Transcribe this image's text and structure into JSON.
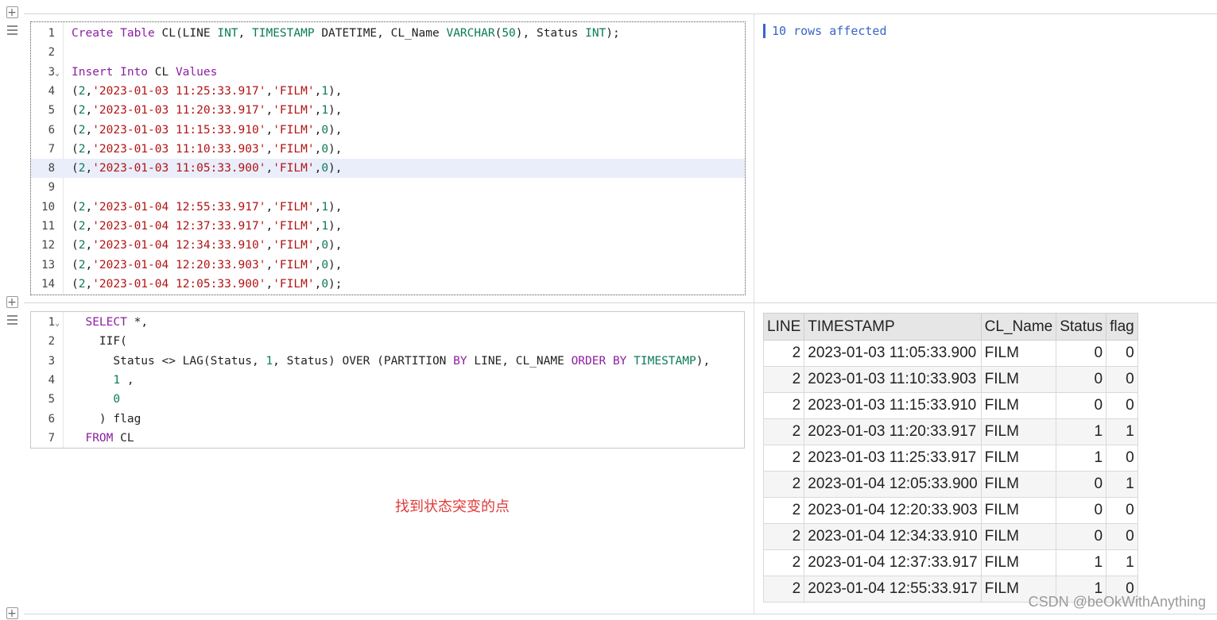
{
  "cell1": {
    "line_numbers": [
      "1",
      "2",
      "3",
      "4",
      "5",
      "6",
      "7",
      "8",
      "9",
      "10",
      "11",
      "12",
      "13",
      "14"
    ],
    "lines": [
      [
        {
          "t": "Create Table",
          "c": "kw"
        },
        {
          "t": " CL(LINE ",
          "c": "pl"
        },
        {
          "t": "INT",
          "c": "ty"
        },
        {
          "t": ", ",
          "c": "pl"
        },
        {
          "t": "TIMESTAMP",
          "c": "ty"
        },
        {
          "t": " DATETIME, CL_Name ",
          "c": "pl"
        },
        {
          "t": "VARCHAR",
          "c": "ty"
        },
        {
          "t": "(",
          "c": "pl"
        },
        {
          "t": "50",
          "c": "nu"
        },
        {
          "t": "), Status ",
          "c": "pl"
        },
        {
          "t": "INT",
          "c": "ty"
        },
        {
          "t": ");",
          "c": "pl"
        }
      ],
      [],
      [
        {
          "t": "Insert Into",
          "c": "kw"
        },
        {
          "t": " CL ",
          "c": "pl"
        },
        {
          "t": "Values",
          "c": "kw"
        }
      ],
      [
        {
          "t": "(",
          "c": "pl"
        },
        {
          "t": "2",
          "c": "nu"
        },
        {
          "t": ",",
          "c": "pl"
        },
        {
          "t": "'2023-01-03 11:25:33.917'",
          "c": "st"
        },
        {
          "t": ",",
          "c": "pl"
        },
        {
          "t": "'FILM'",
          "c": "st"
        },
        {
          "t": ",",
          "c": "pl"
        },
        {
          "t": "1",
          "c": "nu"
        },
        {
          "t": "),",
          "c": "pl"
        }
      ],
      [
        {
          "t": "(",
          "c": "pl"
        },
        {
          "t": "2",
          "c": "nu"
        },
        {
          "t": ",",
          "c": "pl"
        },
        {
          "t": "'2023-01-03 11:20:33.917'",
          "c": "st"
        },
        {
          "t": ",",
          "c": "pl"
        },
        {
          "t": "'FILM'",
          "c": "st"
        },
        {
          "t": ",",
          "c": "pl"
        },
        {
          "t": "1",
          "c": "nu"
        },
        {
          "t": "),",
          "c": "pl"
        }
      ],
      [
        {
          "t": "(",
          "c": "pl"
        },
        {
          "t": "2",
          "c": "nu"
        },
        {
          "t": ",",
          "c": "pl"
        },
        {
          "t": "'2023-01-03 11:15:33.910'",
          "c": "st"
        },
        {
          "t": ",",
          "c": "pl"
        },
        {
          "t": "'FILM'",
          "c": "st"
        },
        {
          "t": ",",
          "c": "pl"
        },
        {
          "t": "0",
          "c": "nu"
        },
        {
          "t": "),",
          "c": "pl"
        }
      ],
      [
        {
          "t": "(",
          "c": "pl"
        },
        {
          "t": "2",
          "c": "nu"
        },
        {
          "t": ",",
          "c": "pl"
        },
        {
          "t": "'2023-01-03 11:10:33.903'",
          "c": "st"
        },
        {
          "t": ",",
          "c": "pl"
        },
        {
          "t": "'FILM'",
          "c": "st"
        },
        {
          "t": ",",
          "c": "pl"
        },
        {
          "t": "0",
          "c": "nu"
        },
        {
          "t": "),",
          "c": "pl"
        }
      ],
      [
        {
          "t": "(",
          "c": "pl"
        },
        {
          "t": "2",
          "c": "nu"
        },
        {
          "t": ",",
          "c": "pl"
        },
        {
          "t": "'2023-01-03 11:05:33.900'",
          "c": "st"
        },
        {
          "t": ",",
          "c": "pl"
        },
        {
          "t": "'FILM'",
          "c": "st"
        },
        {
          "t": ",",
          "c": "pl"
        },
        {
          "t": "0",
          "c": "nu"
        },
        {
          "t": "),",
          "c": "pl"
        }
      ],
      [],
      [
        {
          "t": "(",
          "c": "pl"
        },
        {
          "t": "2",
          "c": "nu"
        },
        {
          "t": ",",
          "c": "pl"
        },
        {
          "t": "'2023-01-04 12:55:33.917'",
          "c": "st"
        },
        {
          "t": ",",
          "c": "pl"
        },
        {
          "t": "'FILM'",
          "c": "st"
        },
        {
          "t": ",",
          "c": "pl"
        },
        {
          "t": "1",
          "c": "nu"
        },
        {
          "t": "),",
          "c": "pl"
        }
      ],
      [
        {
          "t": "(",
          "c": "pl"
        },
        {
          "t": "2",
          "c": "nu"
        },
        {
          "t": ",",
          "c": "pl"
        },
        {
          "t": "'2023-01-04 12:37:33.917'",
          "c": "st"
        },
        {
          "t": ",",
          "c": "pl"
        },
        {
          "t": "'FILM'",
          "c": "st"
        },
        {
          "t": ",",
          "c": "pl"
        },
        {
          "t": "1",
          "c": "nu"
        },
        {
          "t": "),",
          "c": "pl"
        }
      ],
      [
        {
          "t": "(",
          "c": "pl"
        },
        {
          "t": "2",
          "c": "nu"
        },
        {
          "t": ",",
          "c": "pl"
        },
        {
          "t": "'2023-01-04 12:34:33.910'",
          "c": "st"
        },
        {
          "t": ",",
          "c": "pl"
        },
        {
          "t": "'FILM'",
          "c": "st"
        },
        {
          "t": ",",
          "c": "pl"
        },
        {
          "t": "0",
          "c": "nu"
        },
        {
          "t": "),",
          "c": "pl"
        }
      ],
      [
        {
          "t": "(",
          "c": "pl"
        },
        {
          "t": "2",
          "c": "nu"
        },
        {
          "t": ",",
          "c": "pl"
        },
        {
          "t": "'2023-01-04 12:20:33.903'",
          "c": "st"
        },
        {
          "t": ",",
          "c": "pl"
        },
        {
          "t": "'FILM'",
          "c": "st"
        },
        {
          "t": ",",
          "c": "pl"
        },
        {
          "t": "0",
          "c": "nu"
        },
        {
          "t": "),",
          "c": "pl"
        }
      ],
      [
        {
          "t": "(",
          "c": "pl"
        },
        {
          "t": "2",
          "c": "nu"
        },
        {
          "t": ",",
          "c": "pl"
        },
        {
          "t": "'2023-01-04 12:05:33.900'",
          "c": "st"
        },
        {
          "t": ",",
          "c": "pl"
        },
        {
          "t": "'FILM'",
          "c": "st"
        },
        {
          "t": ",",
          "c": "pl"
        },
        {
          "t": "0",
          "c": "nu"
        },
        {
          "t": ");",
          "c": "pl"
        }
      ]
    ],
    "fold_lines": [
      "3"
    ],
    "current_line": "8",
    "output_message": "10 rows affected"
  },
  "cell2": {
    "line_numbers": [
      "1",
      "2",
      "3",
      "4",
      "5",
      "6",
      "7"
    ],
    "lines": [
      [
        {
          "t": "  ",
          "c": "pl"
        },
        {
          "t": "SELECT",
          "c": "kw"
        },
        {
          "t": " *,",
          "c": "pl"
        }
      ],
      [
        {
          "t": "    IIF(",
          "c": "pl"
        }
      ],
      [
        {
          "t": "      Status <> LAG(Status, ",
          "c": "pl"
        },
        {
          "t": "1",
          "c": "nu"
        },
        {
          "t": ", Status) OVER (PARTITION ",
          "c": "pl"
        },
        {
          "t": "BY",
          "c": "kw"
        },
        {
          "t": " LINE, CL_NAME ",
          "c": "pl"
        },
        {
          "t": "ORDER BY",
          "c": "kw"
        },
        {
          "t": " ",
          "c": "pl"
        },
        {
          "t": "TIMESTAMP",
          "c": "ty"
        },
        {
          "t": "),",
          "c": "pl"
        }
      ],
      [
        {
          "t": "      ",
          "c": "pl"
        },
        {
          "t": "1",
          "c": "nu"
        },
        {
          "t": " ,",
          "c": "pl"
        }
      ],
      [
        {
          "t": "      ",
          "c": "pl"
        },
        {
          "t": "0",
          "c": "nu"
        }
      ],
      [
        {
          "t": "    ) flag",
          "c": "pl"
        }
      ],
      [
        {
          "t": "  ",
          "c": "pl"
        },
        {
          "t": "FROM",
          "c": "kw"
        },
        {
          "t": " CL",
          "c": "pl"
        }
      ]
    ],
    "fold_lines": [
      "1"
    ],
    "note": "找到状态突变的点",
    "results": {
      "columns": [
        "LINE",
        "TIMESTAMP",
        "CL_Name",
        "Status",
        "flag"
      ],
      "rows": [
        [
          "2",
          "2023-01-03 11:05:33.900",
          "FILM",
          "0",
          "0"
        ],
        [
          "2",
          "2023-01-03 11:10:33.903",
          "FILM",
          "0",
          "0"
        ],
        [
          "2",
          "2023-01-03 11:15:33.910",
          "FILM",
          "0",
          "0"
        ],
        [
          "2",
          "2023-01-03 11:20:33.917",
          "FILM",
          "1",
          "1"
        ],
        [
          "2",
          "2023-01-03 11:25:33.917",
          "FILM",
          "1",
          "0"
        ],
        [
          "2",
          "2023-01-04 12:05:33.900",
          "FILM",
          "0",
          "1"
        ],
        [
          "2",
          "2023-01-04 12:20:33.903",
          "FILM",
          "0",
          "0"
        ],
        [
          "2",
          "2023-01-04 12:34:33.910",
          "FILM",
          "0",
          "0"
        ],
        [
          "2",
          "2023-01-04 12:37:33.917",
          "FILM",
          "1",
          "1"
        ],
        [
          "2",
          "2023-01-04 12:55:33.917",
          "FILM",
          "1",
          "0"
        ]
      ]
    }
  },
  "icons": {
    "add": "+",
    "fold": "chevron-down-icon",
    "drag": "drag-handle-icon"
  },
  "watermark": "CSDN @beOkWithAnything",
  "colors": {
    "keyword": "#8b1fa0",
    "type": "#0b7a5a",
    "string": "#b21414",
    "output": "#3a64c8",
    "note": "#e03a3a"
  }
}
